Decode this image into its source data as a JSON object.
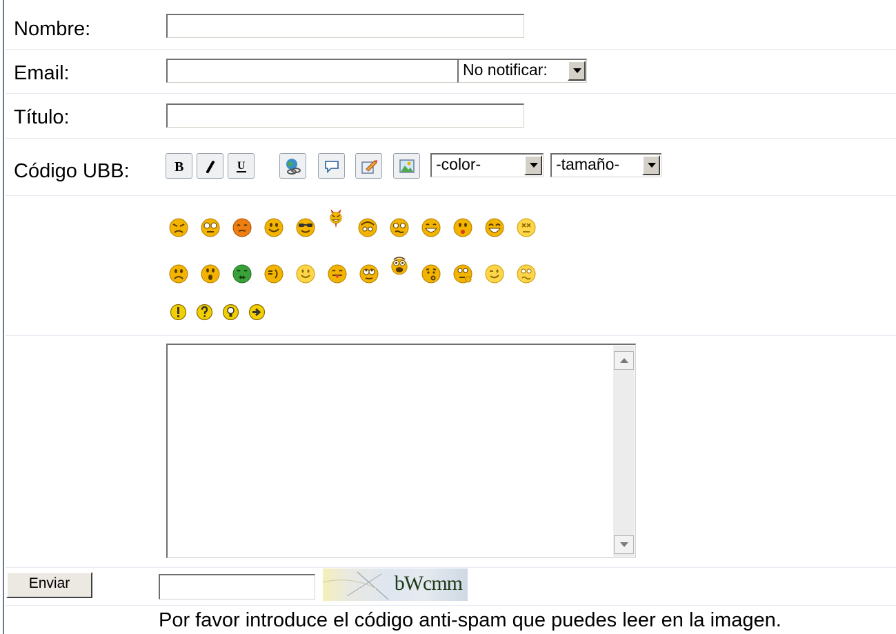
{
  "form": {
    "name_label": "Nombre:",
    "name_value": "",
    "email_label": "Email:",
    "email_value": "",
    "notify_select": "No notificar:",
    "title_label": "Título:",
    "title_value": "",
    "ubb_label": "Código UBB:",
    "color_select": "-color-",
    "size_select": "-tamaño-",
    "message_value": "",
    "submit_label": "Enviar",
    "captcha_input": "",
    "captcha_text": "bWcmm",
    "captcha_notice": "Por favor introduce el código anti-spam que puedes leer en la imagen."
  },
  "toolbar": [
    {
      "name": "bold-icon"
    },
    {
      "name": "italic-icon"
    },
    {
      "name": "underline-icon"
    },
    {
      "name": "link-icon"
    },
    {
      "name": "quote-icon"
    },
    {
      "name": "edit-icon"
    },
    {
      "name": "image-icon"
    }
  ],
  "smileys_row1": [
    "angry-icon",
    "cool-eyes-icon",
    "blush-icon",
    "smile-icon",
    "sunglasses-icon",
    "devil-icon",
    "sleepy-icon",
    "confused-icon",
    "grin-icon",
    "kiss-icon",
    "laugh-icon",
    "dizzy-icon"
  ],
  "smileys_row2": [
    "sad-icon",
    "shocked-icon",
    "sick-icon",
    "neutral-icon",
    "happy-icon",
    "tongue-icon",
    "rolleyes-icon",
    "surprised-icon",
    "whistle-icon",
    "thinking-icon",
    "wink-icon",
    "worried-icon"
  ],
  "symbols_row": [
    "exclamation-icon",
    "question-icon",
    "idea-icon",
    "arrow-icon"
  ],
  "colors": {
    "face": "#f2b400",
    "face_light": "#ffe15a",
    "devil": "#d43a1a",
    "sick": "#3aa13a",
    "left_border": "#6b7a94"
  }
}
